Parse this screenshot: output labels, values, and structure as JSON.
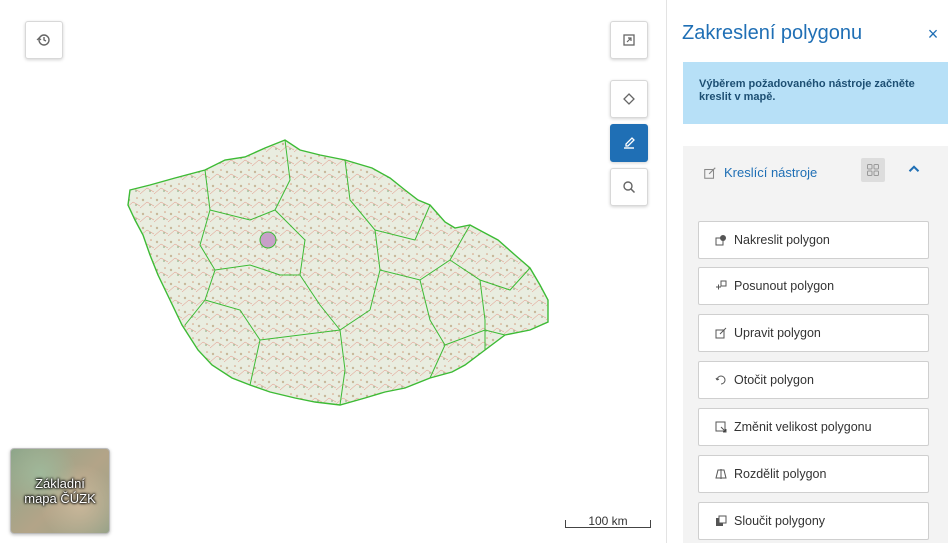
{
  "map": {
    "buttons": {
      "history": "history-icon",
      "fullscreen": "fullscreen-icon",
      "layers": "layers-icon",
      "draw": "draw-icon",
      "search": "search-icon"
    },
    "basemap_label": "Základní mapa ČÚZK",
    "scale_label": "100 km",
    "colors": {
      "region_border": "#3dbb35",
      "accent": "#1f6fb5"
    }
  },
  "panel": {
    "title": "Zakreslení polygonu",
    "close_label": "×",
    "info_text": "Výběrem požadovaného nástroje začněte kreslit v mapě.",
    "tools_header": {
      "label": "Kreslící nástroje",
      "grid_icon": "grid-icon",
      "collapse_icon": "chevron-up-icon"
    },
    "tools": [
      {
        "label": "Nakreslit polygon",
        "icon": "draw-polygon-icon"
      },
      {
        "label": "Posunout polygon",
        "icon": "move-icon"
      },
      {
        "label": "Upravit polygon",
        "icon": "edit-icon"
      },
      {
        "label": "Otočit polygon",
        "icon": "rotate-icon"
      },
      {
        "label": "Změnit velikost polygonu",
        "icon": "resize-icon"
      },
      {
        "label": "Rozdělit polygon",
        "icon": "split-icon"
      },
      {
        "label": "Sloučit polygony",
        "icon": "merge-icon"
      }
    ]
  }
}
